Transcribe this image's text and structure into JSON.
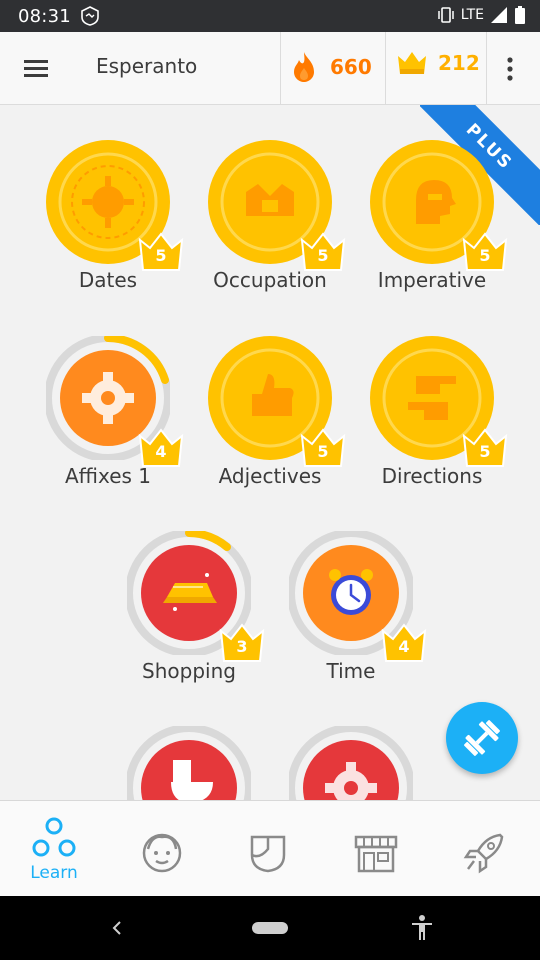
{
  "status_bar": {
    "time": "08:31",
    "network": "LTE"
  },
  "app_bar": {
    "language": "Esperanto",
    "streak": "660",
    "crowns": "212"
  },
  "plus_badge": "PLUS",
  "skills": [
    {
      "label": "Dates",
      "level": "5",
      "color": "#ffc200",
      "progress": 1.0
    },
    {
      "label": "Occupation",
      "level": "5",
      "color": "#ffc200",
      "progress": 1.0
    },
    {
      "label": "Imperative",
      "level": "5",
      "color": "#ffc200",
      "progress": 1.0
    },
    {
      "label": "Affixes 1",
      "level": "4",
      "color": "#ff8a1e",
      "progress": 0.3
    },
    {
      "label": "Adjectives",
      "level": "5",
      "color": "#ffc200",
      "progress": 1.0
    },
    {
      "label": "Directions",
      "level": "5",
      "color": "#ffc200",
      "progress": 1.0
    },
    {
      "label": "Shopping",
      "level": "3",
      "color": "#e5383b",
      "progress": 0.18
    },
    {
      "label": "Time",
      "level": "4",
      "color": "#ff8a1e",
      "progress": 0.0
    }
  ],
  "bottom_nav": {
    "items": [
      {
        "id": "learn",
        "label": "Learn",
        "icon": "learn-icon",
        "active": true
      },
      {
        "id": "profile",
        "icon": "profile-icon"
      },
      {
        "id": "leagues",
        "icon": "shield-icon"
      },
      {
        "id": "shop",
        "icon": "shop-icon"
      },
      {
        "id": "labs",
        "icon": "rocket-icon"
      }
    ]
  },
  "colors": {
    "accent": "#1cb0f6",
    "gold": "#ffc200",
    "orange": "#ff8a1e",
    "red": "#e5383b"
  }
}
